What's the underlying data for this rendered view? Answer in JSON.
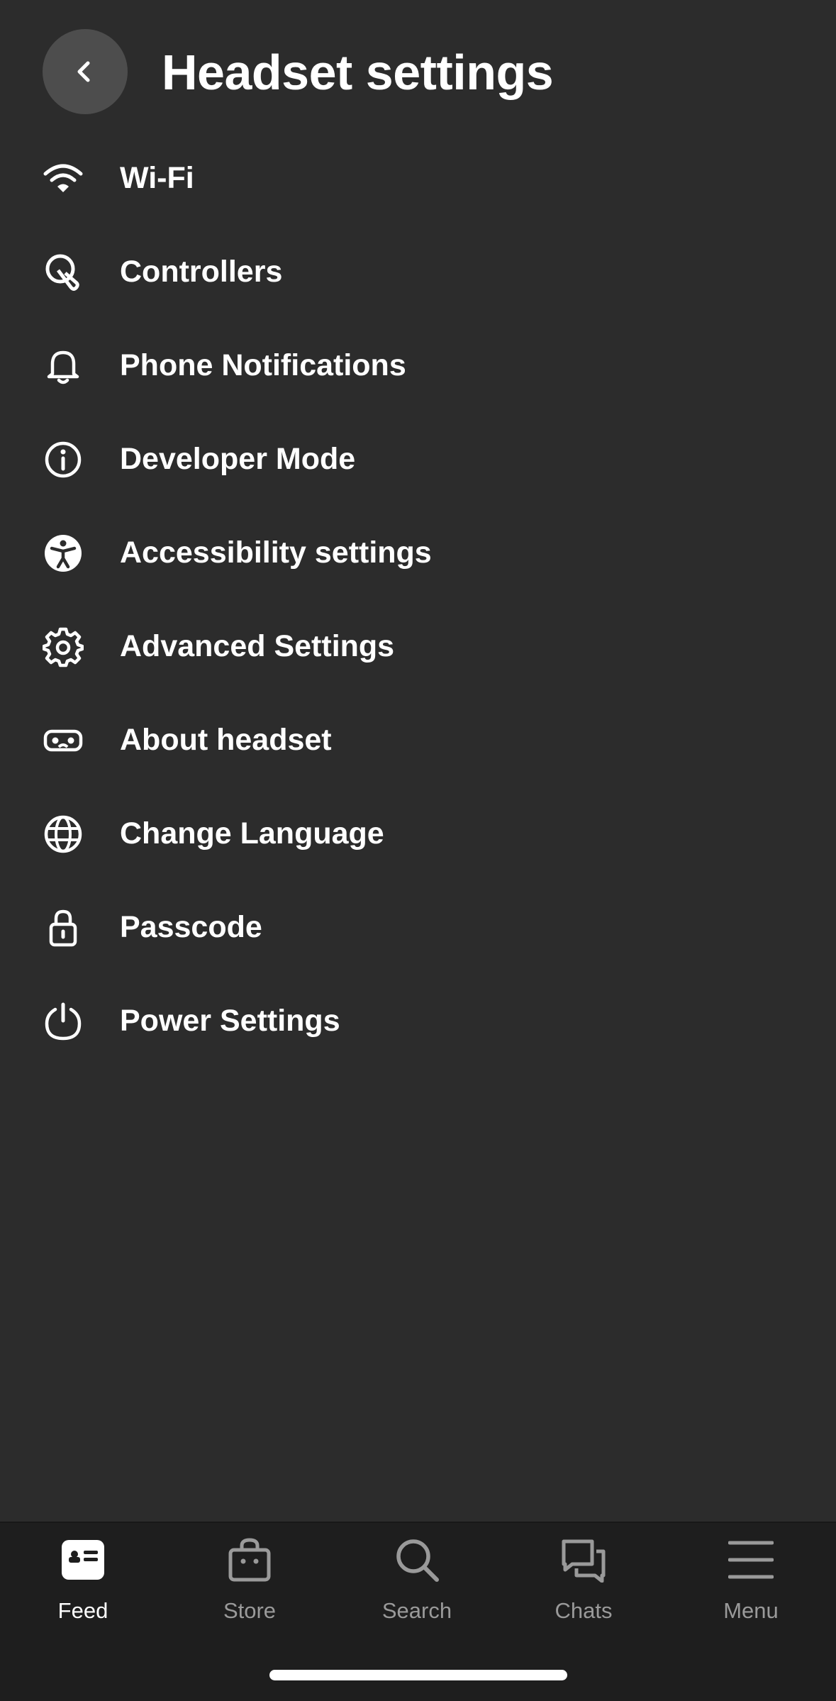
{
  "header": {
    "back_icon": "chevron-left-icon",
    "title": "Headset settings"
  },
  "settings": {
    "items": [
      {
        "label": "Wi-Fi",
        "icon": "wifi-icon"
      },
      {
        "label": "Controllers",
        "icon": "controller-icon"
      },
      {
        "label": "Phone Notifications",
        "icon": "bell-icon"
      },
      {
        "label": "Developer Mode",
        "icon": "info-icon"
      },
      {
        "label": "Accessibility settings",
        "icon": "accessibility-icon"
      },
      {
        "label": "Advanced Settings",
        "icon": "gear-icon"
      },
      {
        "label": "About headset",
        "icon": "headset-icon"
      },
      {
        "label": "Change Language",
        "icon": "globe-icon"
      },
      {
        "label": "Passcode",
        "icon": "lock-icon"
      },
      {
        "label": "Power Settings",
        "icon": "power-icon"
      }
    ]
  },
  "tabbar": {
    "tabs": [
      {
        "label": "Feed",
        "icon": "feed-icon",
        "active": true
      },
      {
        "label": "Store",
        "icon": "store-bag-icon",
        "active": false
      },
      {
        "label": "Search",
        "icon": "search-icon",
        "active": false
      },
      {
        "label": "Chats",
        "icon": "chat-bubbles-icon",
        "active": false
      },
      {
        "label": "Menu",
        "icon": "hamburger-menu-icon",
        "active": false
      }
    ]
  },
  "colors": {
    "background": "#2c2c2c",
    "tabbar_background": "#1e1e1e",
    "back_button": "#4d4d4d",
    "text": "#ffffff",
    "inactive_tab": "#9a9a9a"
  }
}
